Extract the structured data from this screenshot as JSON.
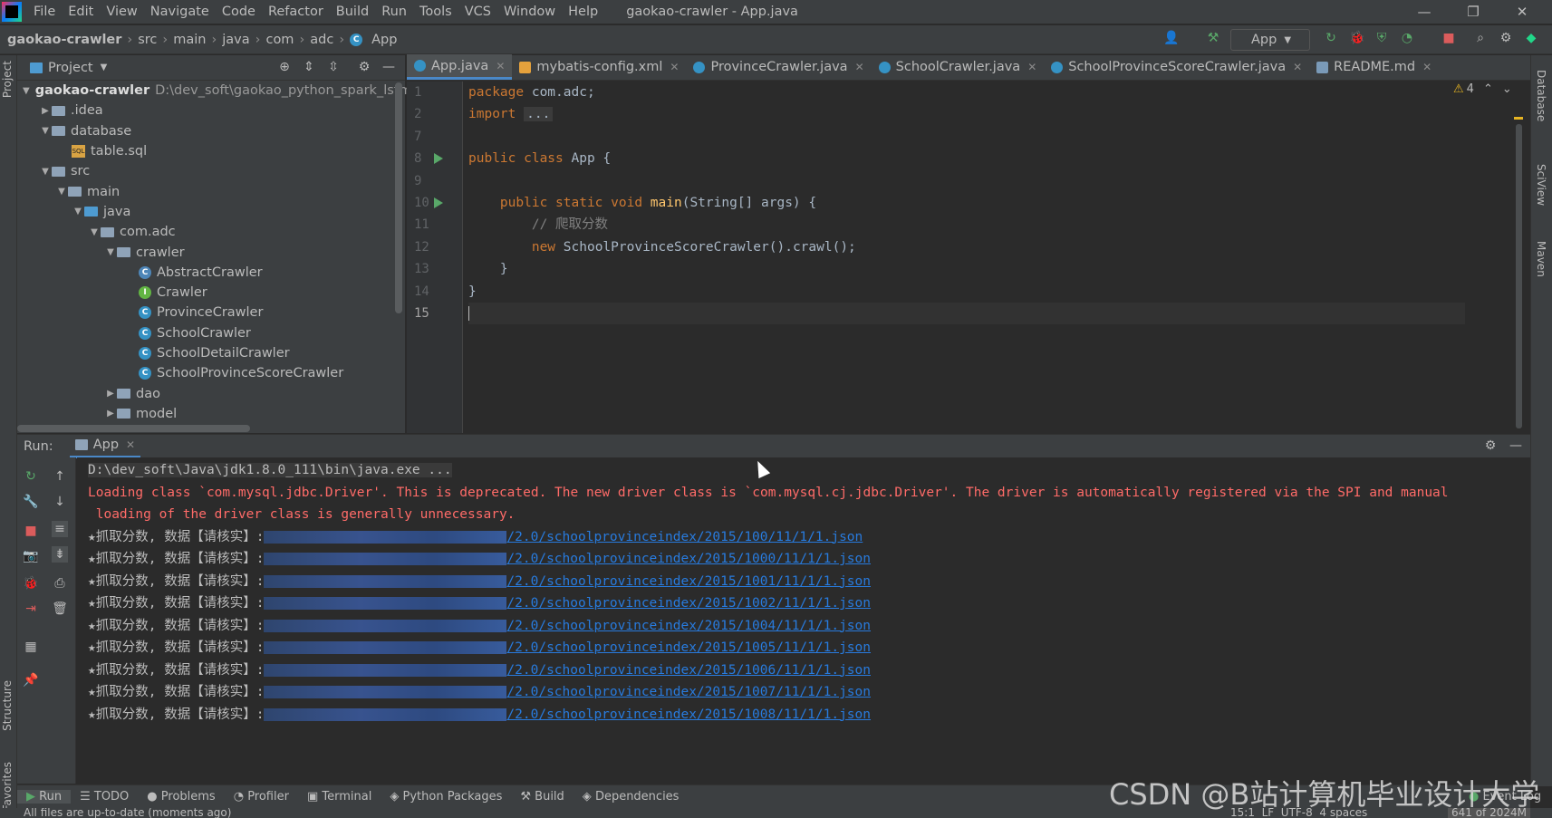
{
  "menubar": {
    "items": [
      "File",
      "Edit",
      "View",
      "Navigate",
      "Code",
      "Refactor",
      "Build",
      "Run",
      "Tools",
      "VCS",
      "Window",
      "Help"
    ],
    "title": "gaokao-crawler - App.java"
  },
  "navbar": {
    "crumbs": [
      "gaokao-crawler",
      "src",
      "main",
      "java",
      "com",
      "adc",
      "App"
    ],
    "run_config": "App"
  },
  "project": {
    "header": "Project",
    "root_name": "gaokao-crawler",
    "root_path": "D:\\dev_soft\\gaokao_python_spark_lstm_",
    "items": [
      ".idea",
      "database",
      "table.sql",
      "src",
      "main",
      "java",
      "com.adc",
      "crawler",
      "AbstractCrawler",
      "Crawler",
      "ProvinceCrawler",
      "SchoolCrawler",
      "SchoolDetailCrawler",
      "SchoolProvinceScoreCrawler",
      "dao",
      "model"
    ]
  },
  "tabs": [
    "App.java",
    "mybatis-config.xml",
    "ProvinceCrawler.java",
    "SchoolCrawler.java",
    "SchoolProvinceScoreCrawler.java",
    "README.md"
  ],
  "editor": {
    "line_numbers": [
      "1",
      "2",
      "7",
      "8",
      "9",
      "10",
      "11",
      "12",
      "13",
      "14",
      "15"
    ],
    "lines": {
      "l1_kw": "package",
      "l1_rest": " com.adc;",
      "l2_kw": "import ",
      "l2_fold": "...",
      "l8_kw": "public class",
      "l8_rest": " App {",
      "l10_kw": "public static void",
      "l10_fn": "main",
      "l10_rest": "(String[] args) {",
      "l11_cm": "// 爬取分数",
      "l12_kw": "new",
      "l12_rest": " SchoolProvinceScoreCrawler().crawl();",
      "l13": "}",
      "l14": "}"
    },
    "warnings": "4"
  },
  "run": {
    "label": "Run:",
    "tab": "App",
    "cmd": "D:\\dev_soft\\Java\\jdk1.8.0_111\\bin\\java.exe ...",
    "err1": "Loading class `com.mysql.jdbc.Driver'. This is deprecated. The new driver class is `com.mysql.cj.jdbc.Driver'. The driver is automatically registered via the SPI and manual",
    "err2": " loading of the driver class is generally unnecessary.",
    "prefix": "★抓取分数, 数据【请核实】:",
    "links": [
      "/2.0/schoolprovinceindex/2015/100/11/1/1.json",
      "/2.0/schoolprovinceindex/2015/1000/11/1/1.json",
      "/2.0/schoolprovinceindex/2015/1001/11/1/1.json",
      "/2.0/schoolprovinceindex/2015/1002/11/1/1.json",
      "/2.0/schoolprovinceindex/2015/1004/11/1/1.json",
      "/2.0/schoolprovinceindex/2015/1005/11/1/1.json",
      "/2.0/schoolprovinceindex/2015/1006/11/1/1.json",
      "/2.0/schoolprovinceindex/2015/1007/11/1/1.json",
      "/2.0/schoolprovinceindex/2015/1008/11/1/1.json"
    ]
  },
  "bottom_tools": [
    "Run",
    "TODO",
    "Problems",
    "Profiler",
    "Terminal",
    "Python Packages",
    "Build",
    "Dependencies"
  ],
  "right_tools": [
    "Database",
    "SciView",
    "Maven"
  ],
  "left_tools": [
    "Project",
    "Structure",
    "Favorites"
  ],
  "status": {
    "left": "All files are up-to-date (moments ago)",
    "right": "15:1  LF  UTF-8  4 spaces",
    "memory": "641 of 2024M",
    "event_log": "Event Log"
  },
  "watermark": "CSDN @B站计算机毕业设计大学"
}
